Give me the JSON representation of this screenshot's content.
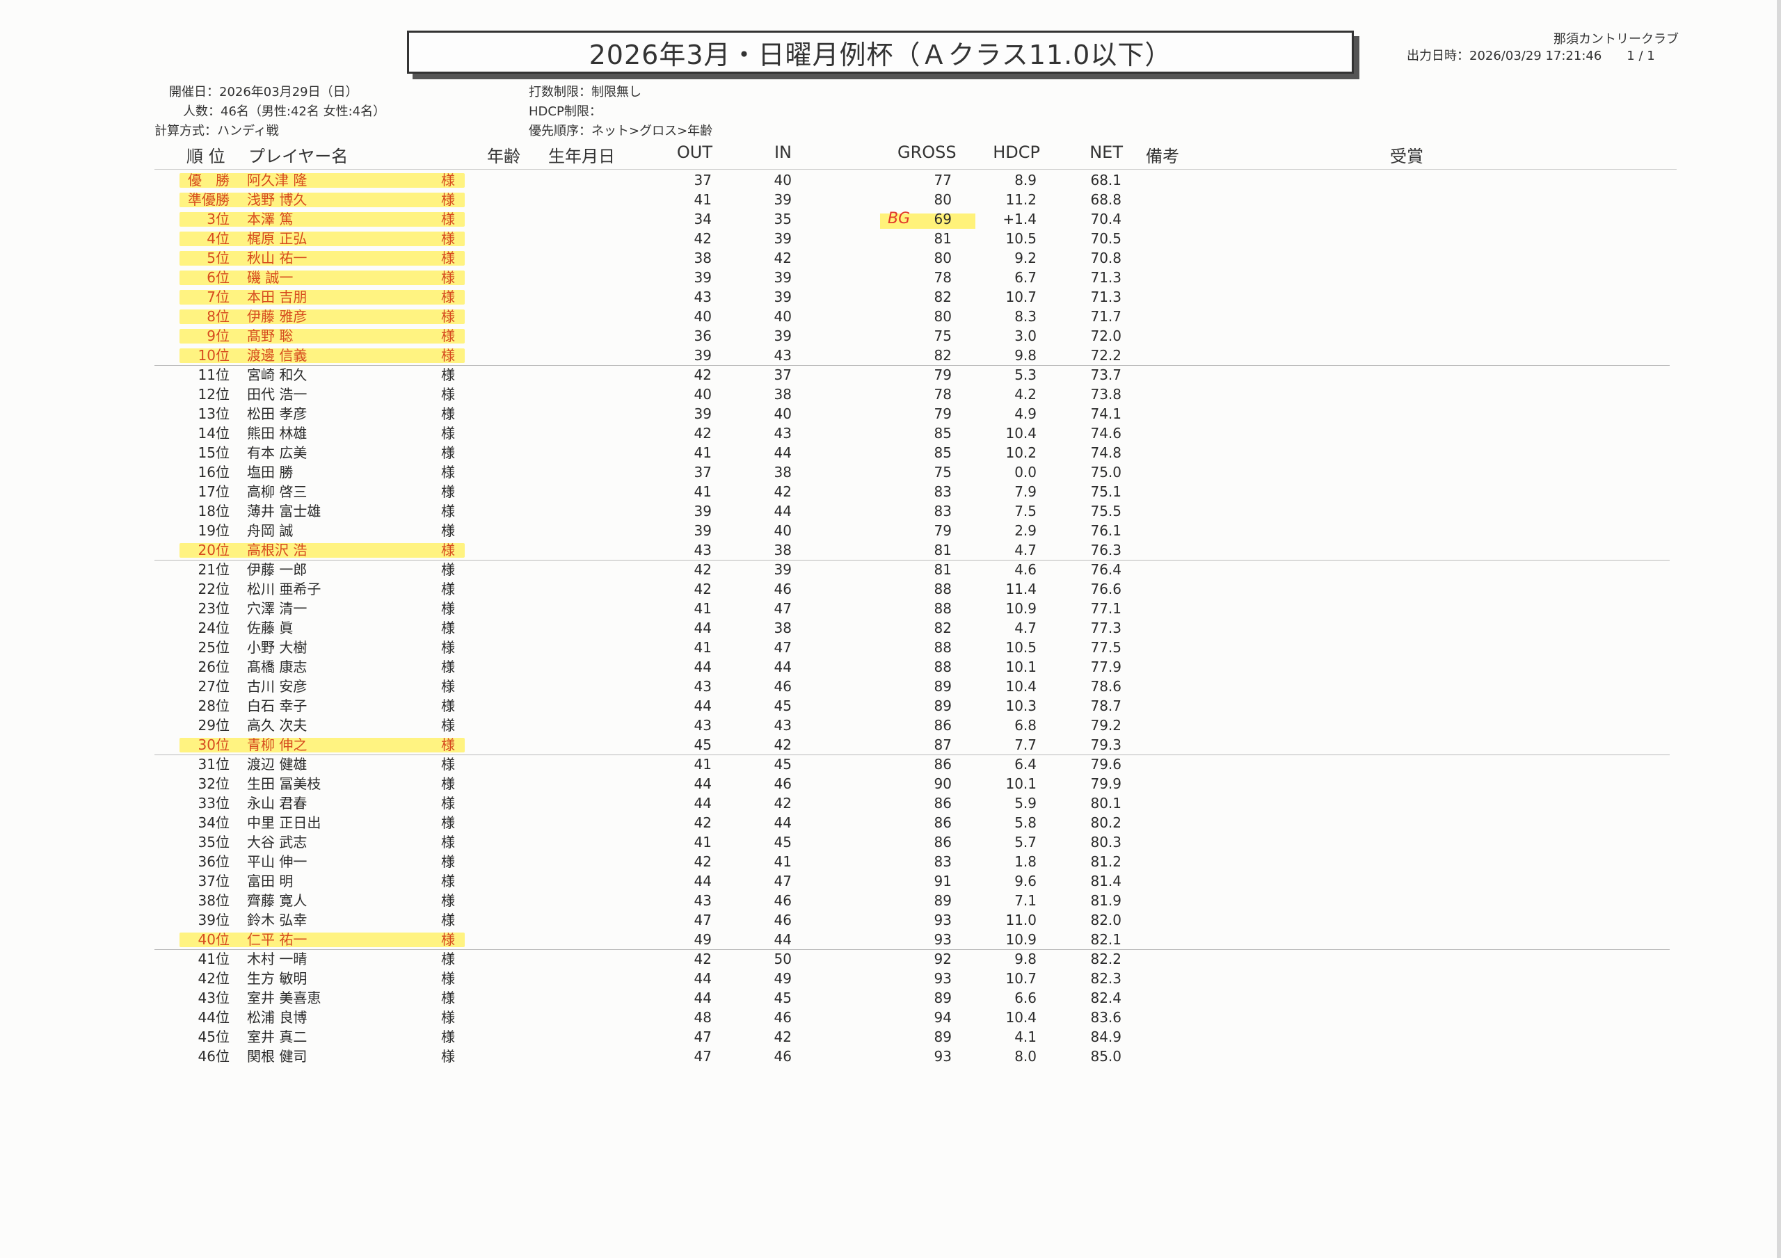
{
  "title": "2026年3月・日曜月例杯（Ａクラス11.0以下）",
  "club": "那須カントリークラブ",
  "printed": "出力日時：2026/03/29 17:21:46　　1 / 1",
  "meta": {
    "date": "開催日：2026年03月29日（日）",
    "count": "人数：46名（男性:42名 女性:4名）",
    "method": "計算方式：ハンディ戦",
    "stroke_limit": "打数制限：制限無し",
    "hdcp_limit": "HDCP制限：",
    "priority": "優先順序：ネット>グロス>年齢"
  },
  "headers": {
    "rank": "順 位",
    "player": "プレイヤー名",
    "age": "年齢",
    "birthday": "生年月日",
    "out": "OUT",
    "in": "IN",
    "gross": "GROSS",
    "hdcp": "HDCP",
    "net": "NET",
    "note": "備考",
    "award": "受賞"
  },
  "honorific": "様",
  "annotation": "BG",
  "highlight_color": "#fff27a",
  "rows": [
    {
      "rank": "優　勝",
      "name": "阿久津 隆",
      "out": "37",
      "in": "40",
      "gross": "77",
      "hdcp": "8.9",
      "net": "68.1",
      "hl": true
    },
    {
      "rank": "準優勝",
      "name": "浅野 博久",
      "out": "41",
      "in": "39",
      "gross": "80",
      "hdcp": "11.2",
      "net": "68.8",
      "hl": true
    },
    {
      "rank": "3位",
      "name": "本澤 篤",
      "out": "34",
      "in": "35",
      "gross": "69",
      "hdcp": "+1.4",
      "net": "70.4",
      "hl": true
    },
    {
      "rank": "4位",
      "name": "梶原 正弘",
      "out": "42",
      "in": "39",
      "gross": "81",
      "hdcp": "10.5",
      "net": "70.5",
      "hl": true
    },
    {
      "rank": "5位",
      "name": "秋山 祐一",
      "out": "38",
      "in": "42",
      "gross": "80",
      "hdcp": "9.2",
      "net": "70.8",
      "hl": true
    },
    {
      "rank": "6位",
      "name": "磯 誠一",
      "out": "39",
      "in": "39",
      "gross": "78",
      "hdcp": "6.7",
      "net": "71.3",
      "hl": true
    },
    {
      "rank": "7位",
      "name": "本田 吉朋",
      "out": "43",
      "in": "39",
      "gross": "82",
      "hdcp": "10.7",
      "net": "71.3",
      "hl": true
    },
    {
      "rank": "8位",
      "name": "伊藤 雅彦",
      "out": "40",
      "in": "40",
      "gross": "80",
      "hdcp": "8.3",
      "net": "71.7",
      "hl": true
    },
    {
      "rank": "9位",
      "name": "髙野 聡",
      "out": "36",
      "in": "39",
      "gross": "75",
      "hdcp": "3.0",
      "net": "72.0",
      "hl": true
    },
    {
      "rank": "10位",
      "name": "渡邊 信義",
      "out": "39",
      "in": "43",
      "gross": "82",
      "hdcp": "9.8",
      "net": "72.2",
      "hl": true
    },
    {
      "rank": "11位",
      "name": "宮崎 和久",
      "out": "42",
      "in": "37",
      "gross": "79",
      "hdcp": "5.3",
      "net": "73.7",
      "hl": false
    },
    {
      "rank": "12位",
      "name": "田代 浩一",
      "out": "40",
      "in": "38",
      "gross": "78",
      "hdcp": "4.2",
      "net": "73.8",
      "hl": false
    },
    {
      "rank": "13位",
      "name": "松田 孝彦",
      "out": "39",
      "in": "40",
      "gross": "79",
      "hdcp": "4.9",
      "net": "74.1",
      "hl": false
    },
    {
      "rank": "14位",
      "name": "熊田 林雄",
      "out": "42",
      "in": "43",
      "gross": "85",
      "hdcp": "10.4",
      "net": "74.6",
      "hl": false
    },
    {
      "rank": "15位",
      "name": "有本 広美",
      "out": "41",
      "in": "44",
      "gross": "85",
      "hdcp": "10.2",
      "net": "74.8",
      "hl": false
    },
    {
      "rank": "16位",
      "name": "塩田 勝",
      "out": "37",
      "in": "38",
      "gross": "75",
      "hdcp": "0.0",
      "net": "75.0",
      "hl": false
    },
    {
      "rank": "17位",
      "name": "高柳 啓三",
      "out": "41",
      "in": "42",
      "gross": "83",
      "hdcp": "7.9",
      "net": "75.1",
      "hl": false
    },
    {
      "rank": "18位",
      "name": "薄井 富士雄",
      "out": "39",
      "in": "44",
      "gross": "83",
      "hdcp": "7.5",
      "net": "75.5",
      "hl": false
    },
    {
      "rank": "19位",
      "name": "舟岡 誠",
      "out": "39",
      "in": "40",
      "gross": "79",
      "hdcp": "2.9",
      "net": "76.1",
      "hl": false
    },
    {
      "rank": "20位",
      "name": "高根沢 浩",
      "out": "43",
      "in": "38",
      "gross": "81",
      "hdcp": "4.7",
      "net": "76.3",
      "hl": true
    },
    {
      "rank": "21位",
      "name": "伊藤 一郎",
      "out": "42",
      "in": "39",
      "gross": "81",
      "hdcp": "4.6",
      "net": "76.4",
      "hl": false
    },
    {
      "rank": "22位",
      "name": "松川 亜希子",
      "out": "42",
      "in": "46",
      "gross": "88",
      "hdcp": "11.4",
      "net": "76.6",
      "hl": false
    },
    {
      "rank": "23位",
      "name": "穴澤 清一",
      "out": "41",
      "in": "47",
      "gross": "88",
      "hdcp": "10.9",
      "net": "77.1",
      "hl": false
    },
    {
      "rank": "24位",
      "name": "佐藤 眞",
      "out": "44",
      "in": "38",
      "gross": "82",
      "hdcp": "4.7",
      "net": "77.3",
      "hl": false
    },
    {
      "rank": "25位",
      "name": "小野 大樹",
      "out": "41",
      "in": "47",
      "gross": "88",
      "hdcp": "10.5",
      "net": "77.5",
      "hl": false
    },
    {
      "rank": "26位",
      "name": "髙橋 康志",
      "out": "44",
      "in": "44",
      "gross": "88",
      "hdcp": "10.1",
      "net": "77.9",
      "hl": false
    },
    {
      "rank": "27位",
      "name": "古川 安彦",
      "out": "43",
      "in": "46",
      "gross": "89",
      "hdcp": "10.4",
      "net": "78.6",
      "hl": false
    },
    {
      "rank": "28位",
      "name": "白石 幸子",
      "out": "44",
      "in": "45",
      "gross": "89",
      "hdcp": "10.3",
      "net": "78.7",
      "hl": false
    },
    {
      "rank": "29位",
      "name": "高久 次夫",
      "out": "43",
      "in": "43",
      "gross": "86",
      "hdcp": "6.8",
      "net": "79.2",
      "hl": false
    },
    {
      "rank": "30位",
      "name": "青柳 伸之",
      "out": "45",
      "in": "42",
      "gross": "87",
      "hdcp": "7.7",
      "net": "79.3",
      "hl": true
    },
    {
      "rank": "31位",
      "name": "渡辺 健雄",
      "out": "41",
      "in": "45",
      "gross": "86",
      "hdcp": "6.4",
      "net": "79.6",
      "hl": false
    },
    {
      "rank": "32位",
      "name": "生田 冨美枝",
      "out": "44",
      "in": "46",
      "gross": "90",
      "hdcp": "10.1",
      "net": "79.9",
      "hl": false
    },
    {
      "rank": "33位",
      "name": "永山 君春",
      "out": "44",
      "in": "42",
      "gross": "86",
      "hdcp": "5.9",
      "net": "80.1",
      "hl": false
    },
    {
      "rank": "34位",
      "name": "中里 正日出",
      "out": "42",
      "in": "44",
      "gross": "86",
      "hdcp": "5.8",
      "net": "80.2",
      "hl": false
    },
    {
      "rank": "35位",
      "name": "大谷 武志",
      "out": "41",
      "in": "45",
      "gross": "86",
      "hdcp": "5.7",
      "net": "80.3",
      "hl": false
    },
    {
      "rank": "36位",
      "name": "平山 伸一",
      "out": "42",
      "in": "41",
      "gross": "83",
      "hdcp": "1.8",
      "net": "81.2",
      "hl": false
    },
    {
      "rank": "37位",
      "name": "富田 明",
      "out": "44",
      "in": "47",
      "gross": "91",
      "hdcp": "9.6",
      "net": "81.4",
      "hl": false
    },
    {
      "rank": "38位",
      "name": "齊藤 寛人",
      "out": "43",
      "in": "46",
      "gross": "89",
      "hdcp": "7.1",
      "net": "81.9",
      "hl": false
    },
    {
      "rank": "39位",
      "name": "鈴木 弘幸",
      "out": "47",
      "in": "46",
      "gross": "93",
      "hdcp": "11.0",
      "net": "82.0",
      "hl": false
    },
    {
      "rank": "40位",
      "name": "仁平 祐一",
      "out": "49",
      "in": "44",
      "gross": "93",
      "hdcp": "10.9",
      "net": "82.1",
      "hl": true
    },
    {
      "rank": "41位",
      "name": "木村 一晴",
      "out": "42",
      "in": "50",
      "gross": "92",
      "hdcp": "9.8",
      "net": "82.2",
      "hl": false
    },
    {
      "rank": "42位",
      "name": "生方 敏明",
      "out": "44",
      "in": "49",
      "gross": "93",
      "hdcp": "10.7",
      "net": "82.3",
      "hl": false
    },
    {
      "rank": "43位",
      "name": "室井 美喜恵",
      "out": "44",
      "in": "45",
      "gross": "89",
      "hdcp": "6.6",
      "net": "82.4",
      "hl": false
    },
    {
      "rank": "44位",
      "name": "松浦 良博",
      "out": "48",
      "in": "46",
      "gross": "94",
      "hdcp": "10.4",
      "net": "83.6",
      "hl": false
    },
    {
      "rank": "45位",
      "name": "室井 真二",
      "out": "47",
      "in": "42",
      "gross": "89",
      "hdcp": "4.1",
      "net": "84.9",
      "hl": false
    },
    {
      "rank": "46位",
      "name": "関根 健司",
      "out": "47",
      "in": "46",
      "gross": "93",
      "hdcp": "8.0",
      "net": "85.0",
      "hl": false
    }
  ]
}
